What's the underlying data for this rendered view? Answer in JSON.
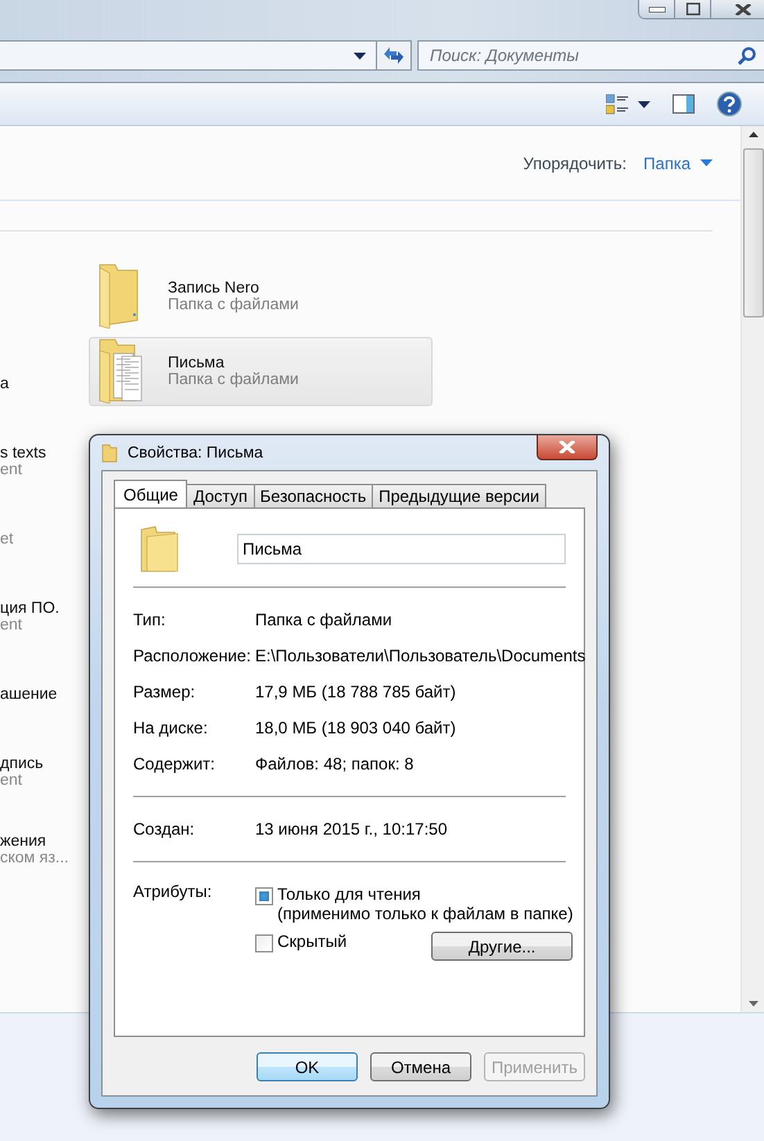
{
  "search": {
    "placeholder": "Поиск: Документы"
  },
  "arrange": {
    "label": "Упорядочить:",
    "value": "Папка"
  },
  "folders": [
    {
      "name": "Запись Nero",
      "type": "Папка с файлами",
      "selected": false,
      "kind": "plain"
    },
    {
      "name": "Письма",
      "type": "Папка с файлами",
      "selected": true,
      "kind": "documents"
    }
  ],
  "left_items": [
    {
      "title": "а"
    },
    {
      "title": "s texts",
      "subtitle": "ent"
    },
    {
      "subtitle": "et"
    },
    {
      "title": "ция ПО.",
      "subtitle": "ent"
    },
    {
      "title": "ашение"
    },
    {
      "title": "дпись",
      "subtitle": "ent"
    },
    {
      "title": "жения",
      "subtitle": "ском яз..."
    }
  ],
  "dialog": {
    "title": "Свойства: Письма",
    "tabs": [
      {
        "label": "Общие",
        "selected": true
      },
      {
        "label": "Доступ",
        "selected": false
      },
      {
        "label": "Безопасность",
        "selected": false
      },
      {
        "label": "Предыдущие версии",
        "selected": false
      }
    ],
    "name": "Письма",
    "groups": [
      [
        {
          "label": "Тип:",
          "value": "Папка с файлами"
        },
        {
          "label": "Расположение:",
          "value": "E:\\Пользователи\\Пользователь\\Documents"
        },
        {
          "label": "Размер:",
          "value": "17,9 МБ (18 788 785 байт)"
        },
        {
          "label": "На диске:",
          "value": "18,0 МБ (18 903 040 байт)"
        },
        {
          "label": "Содержит:",
          "value": "Файлов: 48; папок: 8"
        }
      ],
      [
        {
          "label": "Создан:",
          "value": "13 июня 2015 г., 10:17:50"
        }
      ]
    ],
    "attributes_label": "Атрибуты:",
    "attributes": [
      {
        "label": "Только для чтения",
        "note": "(применимо только к файлам в папке)",
        "checked": true
      },
      {
        "label": "Скрытый",
        "checked": false
      }
    ],
    "advanced_button": "Другие...",
    "buttons": [
      {
        "label": "OK",
        "disabled": false,
        "default": true
      },
      {
        "label": "Отмена",
        "disabled": false,
        "default": false
      },
      {
        "label": "Применить",
        "disabled": true,
        "default": false
      }
    ]
  }
}
